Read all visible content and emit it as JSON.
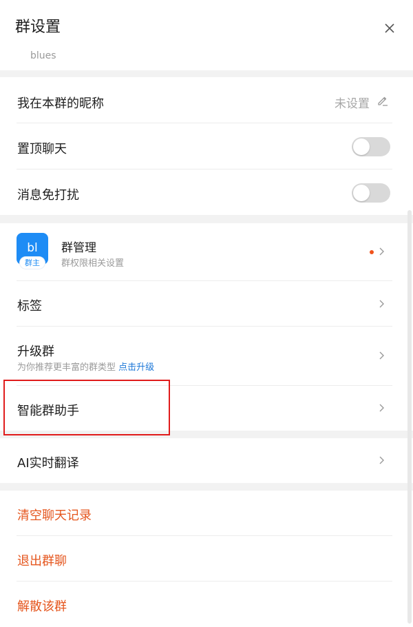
{
  "header": {
    "title": "群设置",
    "close_icon": "close-icon",
    "group_name_partial": "blues"
  },
  "basic": {
    "nickname": {
      "label": "我在本群的昵称",
      "value": "未设置",
      "icon": "edit-pencil-icon"
    },
    "pin_chat": {
      "label": "置顶聊天",
      "on": false
    },
    "mute": {
      "label": "消息免打扰",
      "on": false
    }
  },
  "management": {
    "avatar_text": "bl",
    "owner_badge": "群主",
    "title": "群管理",
    "subtitle": "群权限相关设置",
    "has_notification_dot": true
  },
  "items": {
    "tags": "标签",
    "upgrade": {
      "label": "升级群",
      "subtitle": "为你推荐更丰富的群类型",
      "link": "点击升级"
    },
    "assistant": "智能群助手",
    "ai_translate": "AI实时翻译"
  },
  "danger": {
    "clear_history": "清空聊天记录",
    "leave": "退出群聊",
    "dissolve": "解散该群"
  },
  "colors": {
    "accent": "#1e8cf5",
    "link": "#1e78d8",
    "danger": "#e5561e",
    "dot": "#f0531c",
    "highlight": "#e01b1b"
  }
}
